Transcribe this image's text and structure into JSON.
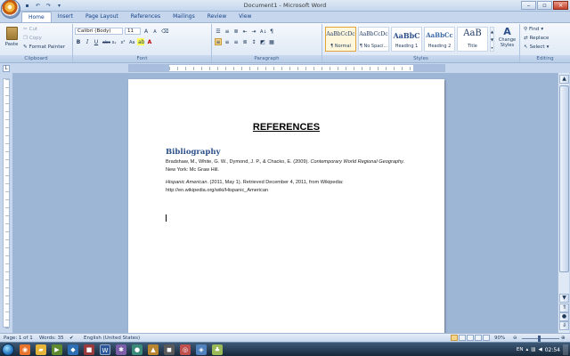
{
  "window": {
    "title": "Document1 - Microsoft Word"
  },
  "tabs": [
    "Home",
    "Insert",
    "Page Layout",
    "References",
    "Mailings",
    "Review",
    "View"
  ],
  "ribbon": {
    "clipboard": {
      "paste": "Paste",
      "cut": "Cut",
      "copy": "Copy",
      "format_painter": "Format Painter",
      "label": "Clipboard"
    },
    "font": {
      "name": "Calibri (Body)",
      "size": "11",
      "label": "Font"
    },
    "paragraph": {
      "label": "Paragraph"
    },
    "styles": {
      "label": "Styles",
      "tiles": [
        {
          "sample": "AaBbCcDc",
          "name": "¶ Normal"
        },
        {
          "sample": "AaBbCcDc",
          "name": "¶ No Spaci..."
        },
        {
          "sample": "AaBbC",
          "name": "Heading 1"
        },
        {
          "sample": "AaBbCc",
          "name": "Heading 2"
        },
        {
          "sample": "AaB",
          "name": "Title"
        }
      ],
      "change_styles": "Change Styles"
    },
    "editing": {
      "find": "Find",
      "replace": "Replace",
      "select": "Select",
      "label": "Editing"
    }
  },
  "document": {
    "heading": "REFERENCES",
    "bibliography_heading": "Bibliography",
    "ref1": {
      "authors": "Bradshaw, M., White, G. W., Dymond, J. P., & Chacko, E. (2009). ",
      "title": "Contemporary World Regional Geography",
      "publisher": ". New York: Mc Graw Hill."
    },
    "ref2": {
      "title": "Hispanic American",
      "rest": ". (2011, May 1). Retrieved December 4, 2011, from Wikipedia:",
      "url": "http://en.wikipedia.org/wiki/Hispanic_American"
    }
  },
  "status": {
    "page": "Page: 1 of 1",
    "words": "Words: 35",
    "language": "English (United States)",
    "zoom": "90%",
    "zoom_level": 0.9
  },
  "taskbar": {
    "lang": "EN",
    "clock": "02:54"
  },
  "colors": {
    "accent": "#2b4f8a",
    "ribbon": "#dbe6f4",
    "doc_background": "#9eb6d6"
  }
}
